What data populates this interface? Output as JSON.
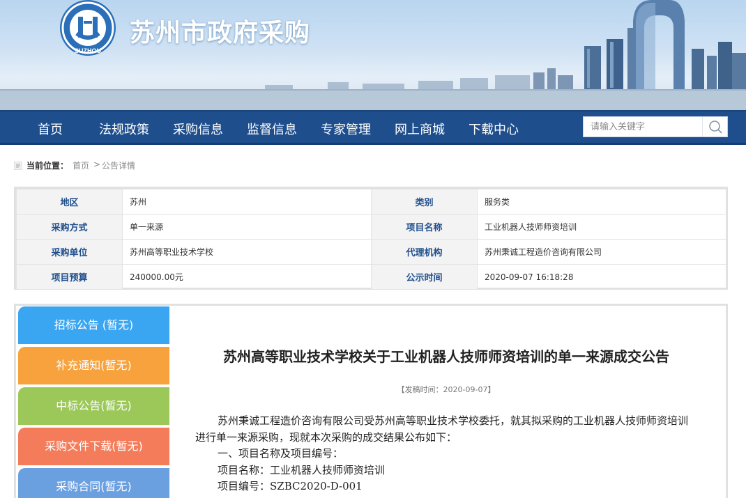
{
  "site": {
    "title": "苏州市政府采购",
    "logo_text": "SUZHOU"
  },
  "nav": {
    "items": [
      "首页",
      "法规政策",
      "采购信息",
      "监督信息",
      "专家管理",
      "网上商城",
      "下载中心"
    ],
    "search_placeholder": "请输入关键字",
    "search_icon": "search-icon"
  },
  "breadcrumb": {
    "label": "当前位置：",
    "home": "首页",
    "separator": ">",
    "current": "公告详情"
  },
  "info": {
    "region_k": "地区",
    "region_v": "苏州",
    "category_k": "类别",
    "category_v": "服务类",
    "method_k": "采购方式",
    "method_v": "单一来源",
    "project_k": "项目名称",
    "project_v": "工业机器人技师师资培训",
    "unit_k": "采购单位",
    "unit_v": "苏州高等职业技术学校",
    "agency_k": "代理机构",
    "agency_v": "苏州秉诚工程造价咨询有限公司",
    "budget_k": "项目预算",
    "budget_v": "240000.00元",
    "time_k": "公示时间",
    "time_v": "2020-09-07 16:18:28"
  },
  "sidebar": {
    "items": [
      {
        "label": "招标公告 (暂无)",
        "color": "#3aa5f0"
      },
      {
        "label": "补充通知(暂无)",
        "color": "#f7a23c"
      },
      {
        "label": "中标公告(暂无)",
        "color": "#9bc858"
      },
      {
        "label": "采购文件下载(暂无)",
        "color": "#f47c5a"
      },
      {
        "label": "采购合同(暂无)",
        "color": "#6a9fe0"
      }
    ]
  },
  "article": {
    "title": "苏州高等职业技术学校关于工业机器人技师师资培训的单一来源成交公告",
    "pub_time": "【发稿时间：2020-09-07】",
    "para1": "苏州秉诚工程造价咨询有限公司受苏州高等职业技术学校委托，就其拟采购的工业机器人技师师资培训进行单一来源采购，现就本次采购的成交结果公布如下：",
    "item1": "一、项目名称及项目编号：",
    "item2": "项目名称：工业机器人技师师资培训",
    "item3": "项目编号：SZBC2020-D-001"
  },
  "colors": {
    "nav_bg": "#1f4e8c",
    "label_blue": "#1f4e8c"
  }
}
